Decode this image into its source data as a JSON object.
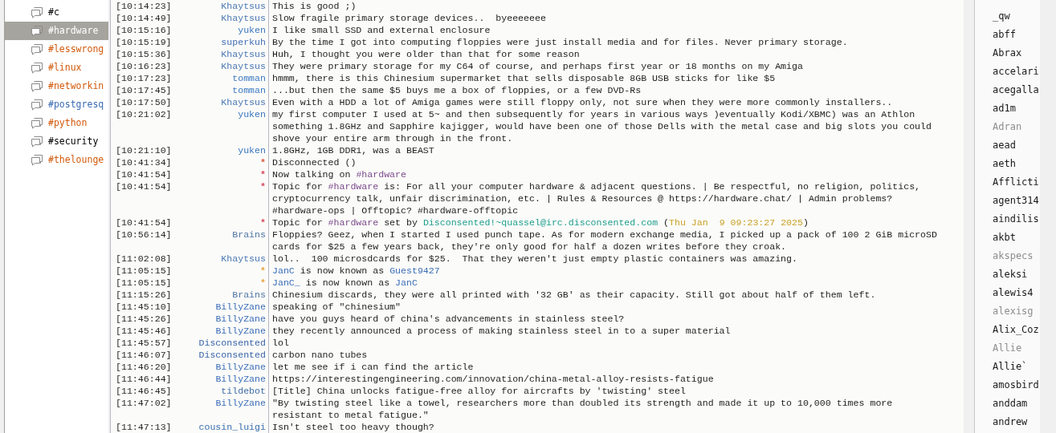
{
  "channels": [
    {
      "name": "#c",
      "color": "#000000",
      "selected": false
    },
    {
      "name": "#hardware",
      "color": "#ffffff",
      "selected": true
    },
    {
      "name": "#lesswrong",
      "color": "#d35a0c",
      "selected": false
    },
    {
      "name": "#linux",
      "color": "#d35a0c",
      "selected": false
    },
    {
      "name": "#networkin",
      "color": "#d35a0c",
      "selected": false
    },
    {
      "name": "#postgresq",
      "color": "#3b6cb3",
      "selected": false
    },
    {
      "name": "#python",
      "color": "#d35a0c",
      "selected": false
    },
    {
      "name": "#security",
      "color": "#000000",
      "selected": false
    },
    {
      "name": "#thelounge",
      "color": "#d35a0c",
      "selected": false
    }
  ],
  "messages": [
    {
      "time": "[10:14:23]",
      "nick": "Khaytsus",
      "color": "#4a78b5",
      "parts": [
        {
          "kind": "text",
          "text": "This is good ;)"
        }
      ]
    },
    {
      "time": "[10:14:49]",
      "nick": "Khaytsus",
      "color": "#4a78b5",
      "parts": [
        {
          "kind": "text",
          "text": "Slow fragile primary storage devices..  byeeeeeee"
        }
      ]
    },
    {
      "time": "[10:15:16]",
      "nick": "yuken",
      "color": "#3b76bd",
      "parts": [
        {
          "kind": "text",
          "text": "I like small SSD and external enclosure"
        }
      ]
    },
    {
      "time": "[10:15:19]",
      "nick": "superkuh",
      "color": "#4270b5",
      "parts": [
        {
          "kind": "text",
          "text": "By the time I got into computing floppies were just install media and for files. Never primary storage."
        }
      ]
    },
    {
      "time": "[10:15:36]",
      "nick": "Khaytsus",
      "color": "#4a78b5",
      "parts": [
        {
          "kind": "text",
          "text": "Huh, I thought you were older than that for some reason"
        }
      ]
    },
    {
      "time": "[10:16:23]",
      "nick": "Khaytsus",
      "color": "#4a78b5",
      "parts": [
        {
          "kind": "text",
          "text": "They were primary storage for my C64 of course, and perhaps first year or 18 months on my Amiga"
        }
      ]
    },
    {
      "time": "[10:17:23]",
      "nick": "tomman",
      "color": "#3a7ac2",
      "parts": [
        {
          "kind": "text",
          "text": "hmmm, there is this Chinesium supermarket that sells disposable 8GB USB sticks for like $5"
        }
      ]
    },
    {
      "time": "[10:17:45]",
      "nick": "tomman",
      "color": "#3a7ac2",
      "parts": [
        {
          "kind": "text",
          "text": "...but then the same $5 buys me a box of floppies, or a few DVD-Rs"
        }
      ]
    },
    {
      "time": "[10:17:50]",
      "nick": "Khaytsus",
      "color": "#4a78b5",
      "parts": [
        {
          "kind": "text",
          "text": "Even with a HDD a lot of Amiga games were still floppy only, not sure when they were more commonly installers.."
        }
      ]
    },
    {
      "time": "[10:21:02]",
      "nick": "yuken",
      "color": "#3b76bd",
      "parts": [
        {
          "kind": "text",
          "text": "my first computer I used at 5~ and then subsequently for years in various ways )eventually Kodi/XBMC) was an Athlon something 1.8GHz and Sapphire kajigger, would have been one of those Dells with the metal case and big slots you could shove your entire arm through in the front."
        }
      ]
    },
    {
      "time": "[10:21:10]",
      "nick": "yuken",
      "color": "#3b76bd",
      "parts": [
        {
          "kind": "text",
          "text": "1.8GHz, 1GB DDR1, was a BEAST"
        }
      ]
    },
    {
      "time": "[10:41:34]",
      "nick": "*",
      "color": "#d9543a",
      "parts": [
        {
          "kind": "text",
          "text": "Disconnected ()"
        }
      ]
    },
    {
      "time": "[10:41:54]",
      "nick": "*",
      "color": "#d9435a",
      "parts": [
        {
          "kind": "text",
          "text": "Now talking on "
        },
        {
          "kind": "channel",
          "text": "#hardware"
        }
      ]
    },
    {
      "time": "[10:41:54]",
      "nick": "*",
      "color": "#d9435a",
      "parts": [
        {
          "kind": "text",
          "text": "Topic for "
        },
        {
          "kind": "channel",
          "text": "#hardware"
        },
        {
          "kind": "text",
          "text": " is: For all your computer hardware & adjacent questions. | Be respectful, no religion, politics, cryptocurrency talk, unfair discrimination, etc. | Rules & Resources @ https://hardware.chat/ | Admin problems? #hardware-ops | Offtopic? #hardware-offtopic"
        }
      ]
    },
    {
      "time": "[10:41:54]",
      "nick": "*",
      "color": "#d9435a",
      "parts": [
        {
          "kind": "text",
          "text": "Topic for "
        },
        {
          "kind": "channel",
          "text": "#hardware"
        },
        {
          "kind": "text",
          "text": " set by "
        },
        {
          "kind": "host",
          "text": "Disconsented!~quassel@irc.disconsented.com"
        },
        {
          "kind": "text",
          "text": " ("
        },
        {
          "kind": "date",
          "text": "Thu Jan  9 09:23:27 2025"
        },
        {
          "kind": "text",
          "text": ")"
        }
      ]
    },
    {
      "time": "[10:56:14]",
      "nick": "Brains",
      "color": "#4f76a3",
      "parts": [
        {
          "kind": "text",
          "text": "Floppies? Geez, when I started I used punch tape. As for modern exchange media, I picked up a pack of 100 2 GiB microSD cards for $25 a few years back, they're only good for half a dozen writes before they croak."
        }
      ]
    },
    {
      "time": "[11:02:08]",
      "nick": "Khaytsus",
      "color": "#4a78b5",
      "parts": [
        {
          "kind": "text",
          "text": "lol..  100 microsdcards for $25.  That they weren't just empty plastic containers was amazing."
        }
      ]
    },
    {
      "time": "[11:05:15]",
      "nick": "*",
      "color": "#e8a03a",
      "parts": [
        {
          "kind": "nick",
          "text": "JanC"
        },
        {
          "kind": "text",
          "text": " is now known as "
        },
        {
          "kind": "nick",
          "text": "Guest9427"
        }
      ]
    },
    {
      "time": "[11:05:15]",
      "nick": "*",
      "color": "#e8a03a",
      "parts": [
        {
          "kind": "nick",
          "text": "JanC_"
        },
        {
          "kind": "text",
          "text": " is now known as "
        },
        {
          "kind": "nick",
          "text": "JanC"
        }
      ]
    },
    {
      "time": "[11:15:26]",
      "nick": "Brains",
      "color": "#4f76a3",
      "parts": [
        {
          "kind": "text",
          "text": "Chinesium discards, they were all printed with '32 GB' as their capacity. Still got about half of them left."
        }
      ]
    },
    {
      "time": "[11:45:10]",
      "nick": "BillyZane",
      "color": "#3d6fb8",
      "parts": [
        {
          "kind": "text",
          "text": "speaking of \"chinesium\""
        }
      ]
    },
    {
      "time": "[11:45:26]",
      "nick": "BillyZane",
      "color": "#3d6fb8",
      "parts": [
        {
          "kind": "text",
          "text": "have you guys heard of china's advancements in stainless steel?"
        }
      ]
    },
    {
      "time": "[11:45:46]",
      "nick": "BillyZane",
      "color": "#3d6fb8",
      "parts": [
        {
          "kind": "text",
          "text": "they recently announced a process of making stainless steel in to a super material"
        }
      ]
    },
    {
      "time": "[11:45:57]",
      "nick": "Disconsented",
      "color": "#3a66a8",
      "parts": [
        {
          "kind": "text",
          "text": "lol"
        }
      ]
    },
    {
      "time": "[11:46:07]",
      "nick": "Disconsented",
      "color": "#3a66a8",
      "parts": [
        {
          "kind": "text",
          "text": "carbon nano tubes"
        }
      ]
    },
    {
      "time": "[11:46:20]",
      "nick": "BillyZane",
      "color": "#3d6fb8",
      "parts": [
        {
          "kind": "text",
          "text": "let me see if i can find the article"
        }
      ]
    },
    {
      "time": "[11:46:44]",
      "nick": "BillyZane",
      "color": "#3d6fb8",
      "parts": [
        {
          "kind": "text",
          "text": "https://interestingengineering.com/innovation/china-metal-alloy-resists-fatigue"
        }
      ]
    },
    {
      "time": "[11:46:45]",
      "nick": "tildebot",
      "color": "#3f6ea6",
      "parts": [
        {
          "kind": "text",
          "text": "[Title] China unlocks fatigue-free alloy for aircrafts by 'twisting' steel"
        }
      ]
    },
    {
      "time": "[11:47:02]",
      "nick": "BillyZane",
      "color": "#3d6fb8",
      "parts": [
        {
          "kind": "text",
          "text": "\"By twisting steel like a towel, researchers more than doubled its strength and made it up to 10,000 times more resistant to metal fatigue.\""
        }
      ]
    },
    {
      "time": "[11:47:13]",
      "nick": "cousin_luigi",
      "color": "#3a70b0",
      "parts": [
        {
          "kind": "text",
          "text": "Isn't steel too heavy though?"
        }
      ]
    }
  ],
  "nicks": [
    {
      "name": "_qw",
      "away": false
    },
    {
      "name": "abff",
      "away": false
    },
    {
      "name": "Abrax",
      "away": false
    },
    {
      "name": "accelari",
      "away": false
    },
    {
      "name": "acegalla",
      "away": false
    },
    {
      "name": "ad1m",
      "away": false
    },
    {
      "name": "Adran",
      "away": true
    },
    {
      "name": "aead",
      "away": false
    },
    {
      "name": "aeth",
      "away": false
    },
    {
      "name": "Afflicti",
      "away": false
    },
    {
      "name": "agent314",
      "away": false
    },
    {
      "name": "aindilis",
      "away": false
    },
    {
      "name": "akbt",
      "away": false
    },
    {
      "name": "akspecs",
      "away": true
    },
    {
      "name": "aleksi",
      "away": false
    },
    {
      "name": "alewis4",
      "away": false
    },
    {
      "name": "alexisg",
      "away": true
    },
    {
      "name": "Alix_Coz",
      "away": false
    },
    {
      "name": "Allie",
      "away": true
    },
    {
      "name": "Allie`",
      "away": false
    },
    {
      "name": "amosbird",
      "away": false
    },
    {
      "name": "anddam",
      "away": false
    },
    {
      "name": "andrew",
      "away": false
    }
  ]
}
